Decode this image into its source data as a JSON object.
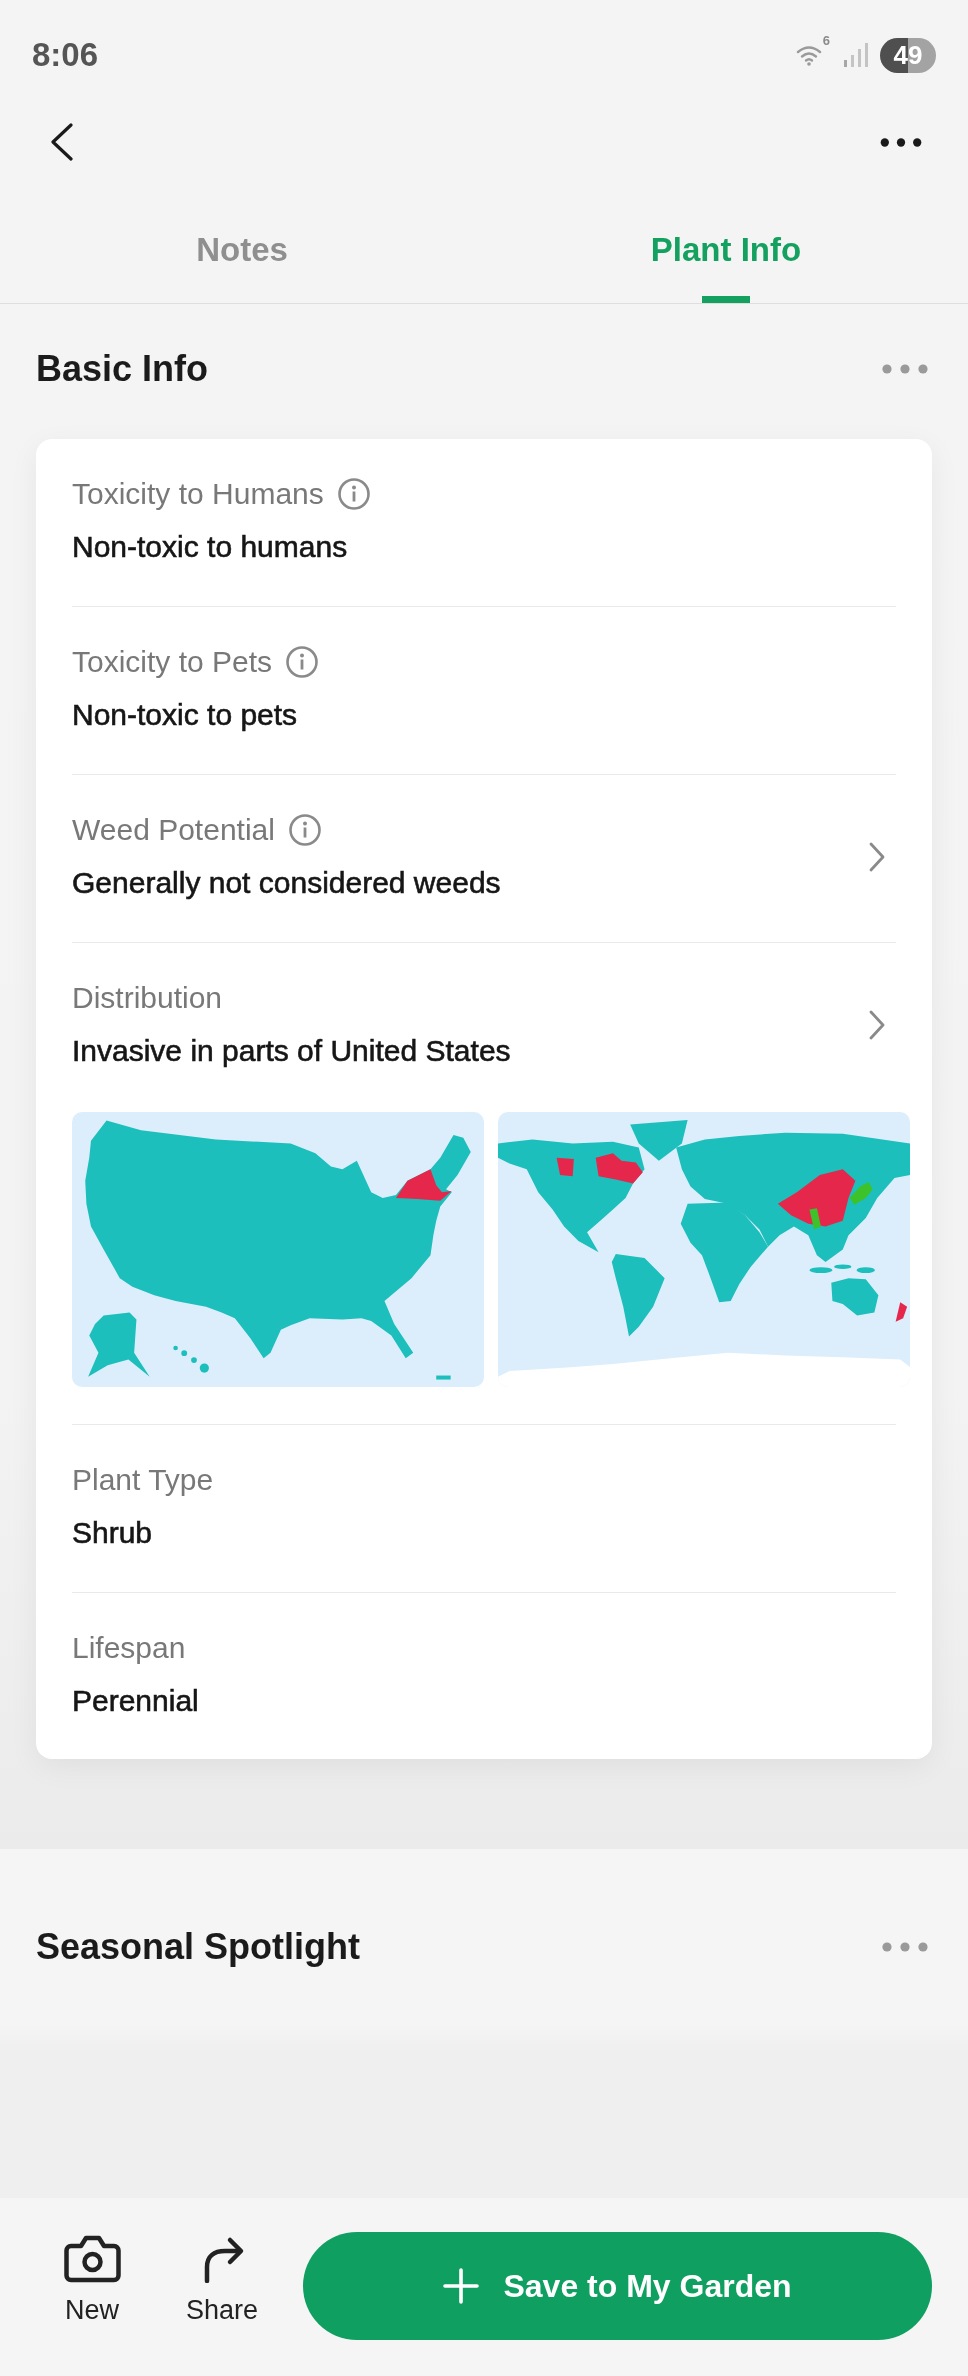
{
  "status_bar": {
    "time": "8:06",
    "wifi_label": "6",
    "battery": "49"
  },
  "tabs": [
    {
      "label": "Notes",
      "selected": false
    },
    {
      "label": "Plant Info",
      "selected": true
    }
  ],
  "basic_info": {
    "title": "Basic Info",
    "items": [
      {
        "label": "Toxicity to Humans",
        "value": "Non-toxic to humans",
        "info": true,
        "expandable": false
      },
      {
        "label": "Toxicity to Pets",
        "value": "Non-toxic to pets",
        "info": true,
        "expandable": false
      },
      {
        "label": "Weed Potential",
        "value": "Generally not considered weeds",
        "info": true,
        "expandable": true
      },
      {
        "label": "Distribution",
        "value": "Invasive in parts of United States",
        "info": false,
        "expandable": true,
        "maps": [
          {
            "kind": "us"
          },
          {
            "kind": "world"
          }
        ]
      },
      {
        "label": "Plant Type",
        "value": "Shrub",
        "info": false,
        "expandable": false
      },
      {
        "label": "Lifespan",
        "value": "Perennial",
        "info": false,
        "expandable": false
      }
    ]
  },
  "seasonal_spotlight": {
    "title": "Seasonal Spotlight"
  },
  "bottom_bar": {
    "actions": [
      {
        "kind": "camera",
        "label": "New"
      },
      {
        "kind": "share",
        "label": "Share"
      }
    ],
    "primary_button": "Save to My Garden"
  }
}
